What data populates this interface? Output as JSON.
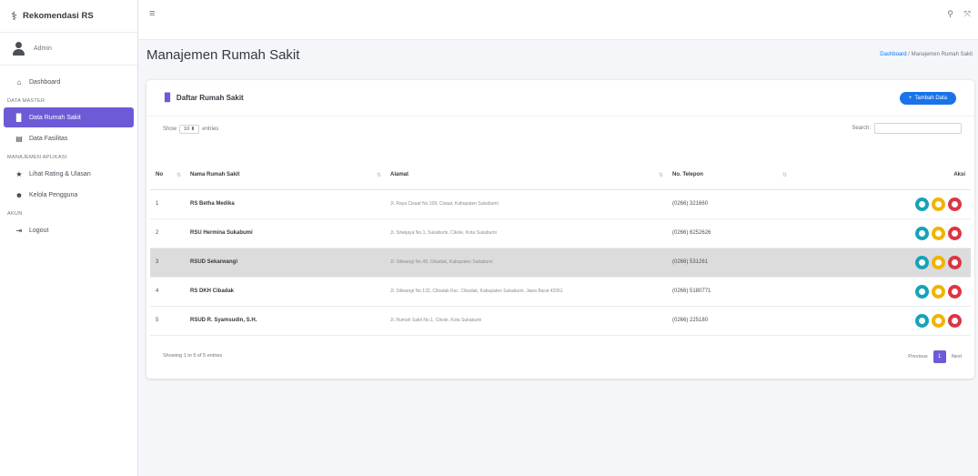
{
  "brand": {
    "title": "Rekomendasi RS"
  },
  "user": {
    "name": "Admin"
  },
  "sidebar": {
    "dashboard": "Dashboard",
    "section_master": "DATA MASTER",
    "data_rumah_sakit": "Data Rumah Sakit",
    "data_fasilitas": "Data Fasilitas",
    "section_manajemen": "MANAJEMEN APLIKASI",
    "lihat_rating": "Lihat Rating & Ulasan",
    "kelola_pengguna": "Kelola Pengguna",
    "section_akun": "AKUN",
    "logout": "Logout"
  },
  "page": {
    "title": "Manajemen Rumah Sakit",
    "breadcrumb_link": "Dashboard",
    "breadcrumb_sep": " / ",
    "breadcrumb_current": "Manajemen Rumah Sakit"
  },
  "card": {
    "title": "Daftar Rumah Sakit",
    "add_label": "Tambah Data",
    "show_label": "Show",
    "show_value": "10",
    "entries_label": "entries",
    "search_label": "Search:"
  },
  "table": {
    "headers": [
      "No",
      "Nama Rumah Sakit",
      "Alamat",
      "No. Telepon",
      "Aksi"
    ],
    "rows": [
      {
        "no": "1",
        "name": "RS Betha Medika",
        "address": "Jl. Raya Cisaat No.109, Cisaat, Kabupaten Sukabumi",
        "phone": "(0266) 321660"
      },
      {
        "no": "2",
        "name": "RSU Hermina Sukabumi",
        "address": "Jl. Sriwijaya No.1, Sukabumi, Cikole, Kota Sukabumi",
        "phone": "(0266) 6252626"
      },
      {
        "no": "3",
        "name": "RSUD Sekarwangi",
        "address": "Jl. Siliwangi No.49, Cibadak, Kabupaten Sukabumi",
        "phone": "(0266) 531261"
      },
      {
        "no": "4",
        "name": "RS DKH Cibadak",
        "address": "Jl. Siliwangi No.132, Cibadak Kec. Cibadak, Kabupaten Sukabumi, Jawa Barat 43351",
        "phone": "(0266) 5180771"
      },
      {
        "no": "5",
        "name": "RSUD R. Syamsudin, S.H.",
        "address": "Jl. Rumah Sakit No.1, Cikole, Kota Sukabumi",
        "phone": "(0266) 225180"
      }
    ]
  },
  "footer": {
    "info": "Showing 1 to 5 of 5 entries",
    "previous": "Previous",
    "page": "1",
    "next": "Next"
  }
}
